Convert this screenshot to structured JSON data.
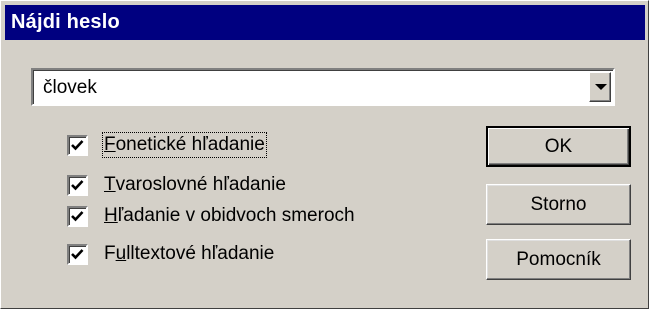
{
  "window": {
    "title": "Nájdi heslo",
    "title_bar_color": "#000080",
    "background_color": "#d4d0c8"
  },
  "search": {
    "value": "človek",
    "dropdown_icon": "chevron-down-icon"
  },
  "options": [
    {
      "prefix": "",
      "accel": "F",
      "rest": "onetické hľadanie",
      "checked": true
    },
    {
      "prefix": "",
      "accel": "T",
      "rest": "varoslovné hľadanie",
      "checked": true
    },
    {
      "prefix": "",
      "accel": "H",
      "rest": "ľadanie v obidvoch smeroch",
      "checked": true
    },
    {
      "prefix": "F",
      "accel": "u",
      "rest": "lltextové hľadanie",
      "checked": true
    }
  ],
  "buttons": {
    "ok": "OK",
    "cancel": "Storno",
    "help": "Pomocník"
  }
}
